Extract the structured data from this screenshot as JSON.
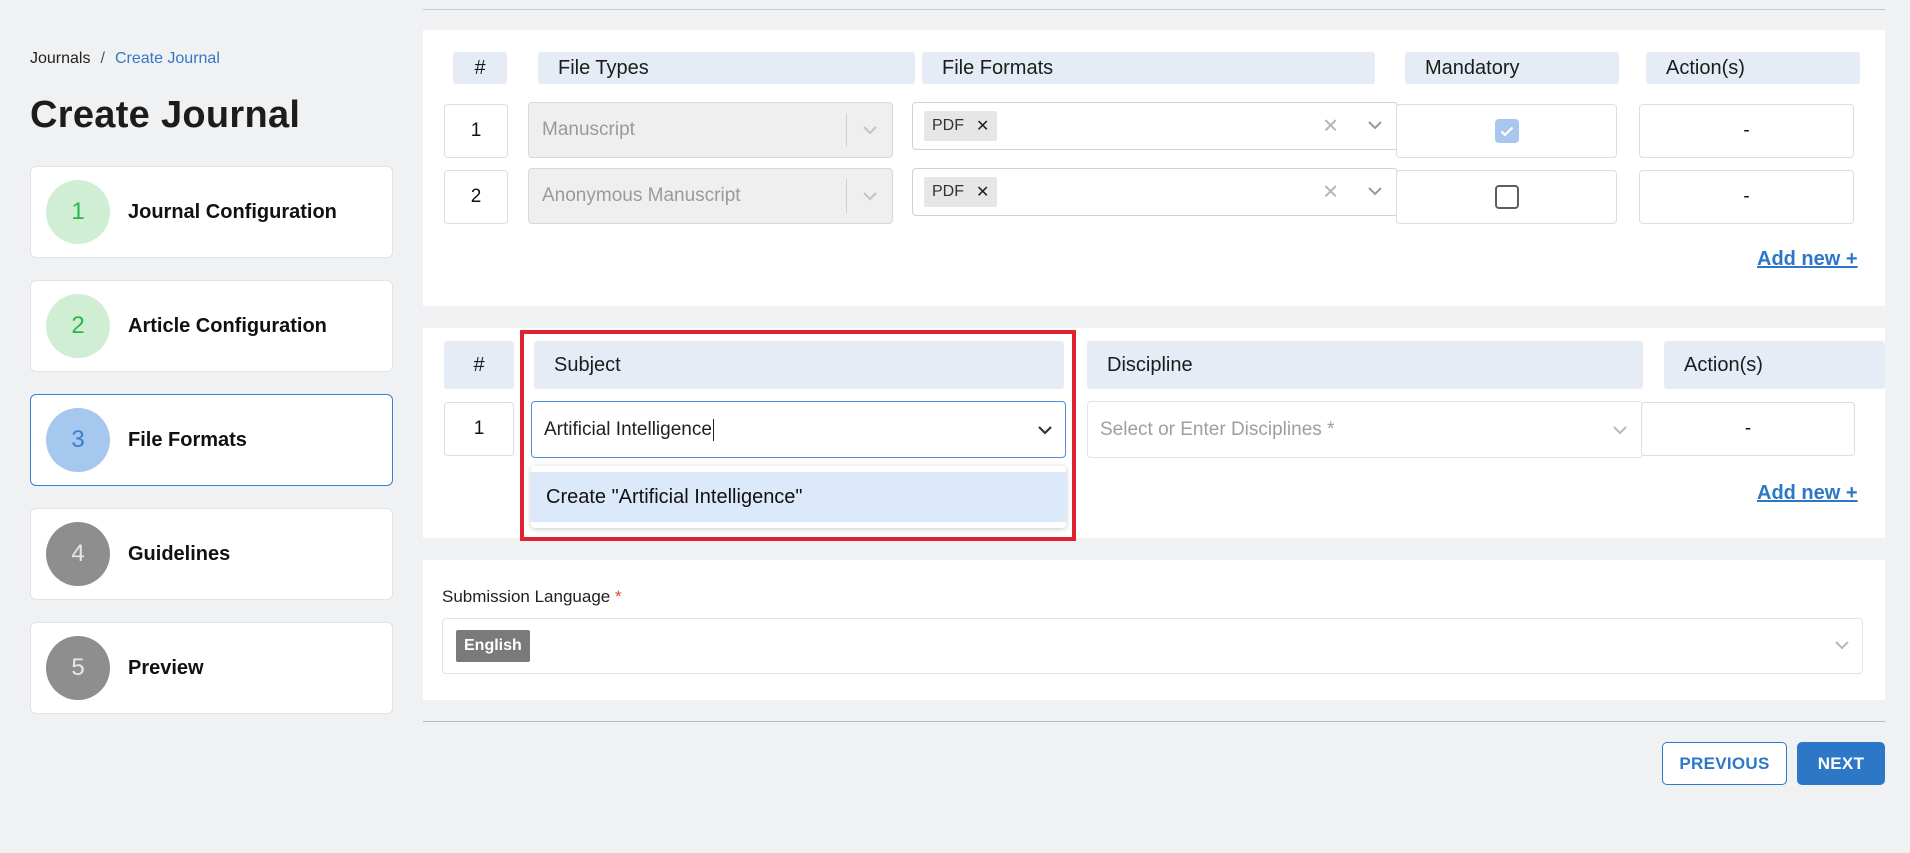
{
  "breadcrumb": {
    "root": "Journals",
    "separator": "/",
    "current": "Create Journal"
  },
  "page_title": "Create Journal",
  "steps": [
    {
      "number": "1",
      "label": "Journal Configuration",
      "status": "done"
    },
    {
      "number": "2",
      "label": "Article Configuration",
      "status": "done"
    },
    {
      "number": "3",
      "label": "File Formats",
      "status": "current"
    },
    {
      "number": "4",
      "label": "Guidelines",
      "status": "todo"
    },
    {
      "number": "5",
      "label": "Preview",
      "status": "todo"
    }
  ],
  "file_types_table": {
    "headers": {
      "index": "#",
      "file_types": "File Types",
      "file_formats": "File Formats",
      "mandatory": "Mandatory",
      "actions": "Action(s)"
    },
    "rows": [
      {
        "index": "1",
        "file_type": "Manuscript",
        "format_chip": "PDF",
        "mandatory": true,
        "action": "-"
      },
      {
        "index": "2",
        "file_type": "Anonymous Manuscript",
        "format_chip": "PDF",
        "mandatory": false,
        "action": "-"
      }
    ],
    "add_new": "Add new +"
  },
  "subject_table": {
    "headers": {
      "index": "#",
      "subject": "Subject",
      "discipline": "Discipline",
      "actions": "Action(s)"
    },
    "row": {
      "index": "1",
      "subject_value": "Artificial Intelligence",
      "discipline_placeholder": "Select or Enter Disciplines *",
      "action": "-"
    },
    "dropdown_option": "Create \"Artificial Intelligence\"",
    "add_new": "Add new +"
  },
  "submission_language": {
    "label": "Submission Language",
    "required_mark": "*",
    "selected": "English"
  },
  "buttons": {
    "previous": "PREVIOUS",
    "next": "NEXT"
  },
  "colors": {
    "accent": "#2c77c6",
    "highlight": "#e0242f",
    "done_green": "#2bb84a",
    "header_bg": "#e6ecf5"
  }
}
